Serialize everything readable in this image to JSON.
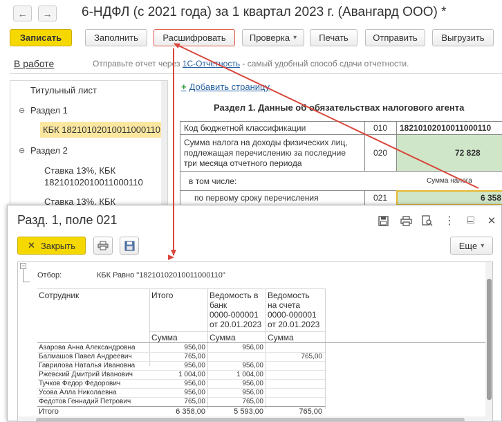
{
  "window": {
    "back_glyph": "←",
    "forward_glyph": "→",
    "title": "6-НДФЛ (с 2021 года) за 1 квартал 2023 г. (Авангард ООО) *"
  },
  "toolbar": {
    "save": "Записать",
    "fill": "Заполнить",
    "decode": "Расшифровать",
    "check": "Проверка",
    "check_arrow": "▾",
    "print": "Печать",
    "send": "Отправить",
    "upload": "Выгрузить"
  },
  "status": {
    "state": "В работе",
    "hint_prefix": "Отправьте отчет через ",
    "hint_link": "1С-Отчетность",
    "hint_suffix": " - самый удобный способ сдачи отчетности."
  },
  "tree": {
    "title_page": "Титульный лист",
    "section1": "Раздел 1",
    "section1_kbk": "КБК 18210102010011000110",
    "section2": "Раздел 2",
    "rate1_line1": "Ставка 13%, КБК",
    "rate1_line2": "18210102010011000110",
    "rate2_line1": "Ставка 13%, КБК",
    "toggle": "⊖"
  },
  "form": {
    "add_page": "Добавить страницу",
    "add_plus": "+",
    "section_title": "Раздел 1. Данные об обязательствах налогового агента",
    "kbk_label": "Код бюджетной классификации",
    "kbk_code": "010",
    "kbk_value": "18210102010011000110",
    "f020_label_1": "Сумма налога на доходы физических лиц,",
    "f020_label_2": "подлежащая перечислению за последние",
    "f020_label_3": "три месяца отчетного периода",
    "f020_code": "020",
    "f020_value": "72 828",
    "incl_label": "в том числе:",
    "tax_sum_header": "Сумма налога",
    "f021_label": "по первому сроку перечисления",
    "f021_code": "021",
    "f021_value": "6 358"
  },
  "popup": {
    "title": "Разд. 1, поле 021",
    "close_label": "Закрыть",
    "close_icon": "✕",
    "more_label": "Еще",
    "more_arrow": "▾",
    "window_minimize": "–",
    "window_maximize": "□",
    "window_close": "✕"
  },
  "report": {
    "filter_label": "Отбор:",
    "filter_value": "КБК Равно \"18210102010011000110\"",
    "columns": {
      "employee": "Сотрудник",
      "total": "Итого",
      "bank_1": "Ведомость в",
      "bank_2": "банк",
      "bank_3": "0000-000001",
      "bank_4": "от 20.01.2023",
      "cash_1": "Ведомость",
      "cash_2": "на счета",
      "cash_3": "0000-000001",
      "cash_4": "от 20.01.2023",
      "sum": "Сумма"
    },
    "rows": [
      {
        "name": "Азарова Анна Александровна",
        "total": "956,00",
        "bank": "956,00",
        "cash": ""
      },
      {
        "name": "Балмашов Павел Андреевич",
        "total": "765,00",
        "bank": "",
        "cash": "765,00"
      },
      {
        "name": "Гаврилова Наталья Ивановна",
        "total": "956,00",
        "bank": "956,00",
        "cash": ""
      },
      {
        "name": "Ржевский Дмитрий Иванович",
        "total": "1 004,00",
        "bank": "1 004,00",
        "cash": ""
      },
      {
        "name": "Тучков Федор Федорович",
        "total": "956,00",
        "bank": "956,00",
        "cash": ""
      },
      {
        "name": "Усова Алла Николаевна",
        "total": "956,00",
        "bank": "956,00",
        "cash": ""
      },
      {
        "name": "Федотов Геннадий Петрович",
        "total": "765,00",
        "bank": "765,00",
        "cash": ""
      }
    ],
    "totals": {
      "name": "Итого",
      "total": "6 358,00",
      "bank": "5 593,00",
      "cash": "765,00"
    },
    "collapse_glyph": "−"
  },
  "colors": {
    "accent_yellow": "#f5d800",
    "link_blue": "#2561a3",
    "cell_green": "#cfe6c8",
    "arrow_red": "#d9463b",
    "selected_tree": "#fbe7a0"
  }
}
